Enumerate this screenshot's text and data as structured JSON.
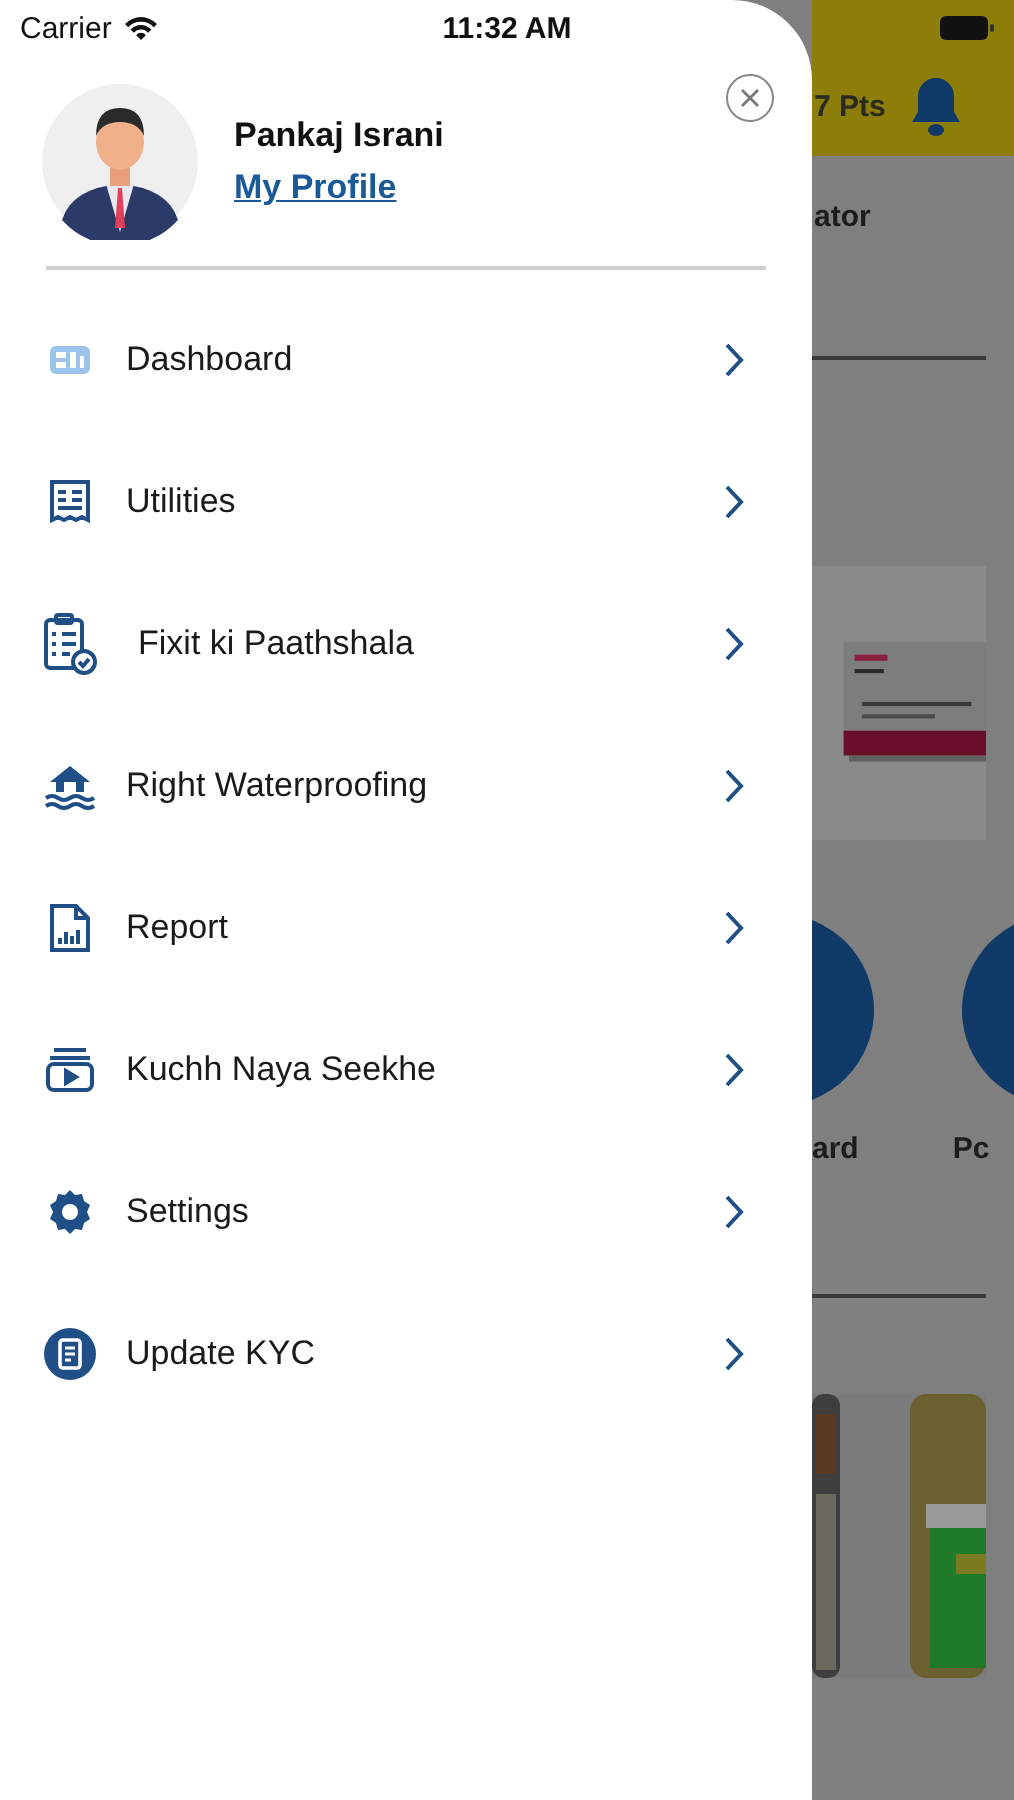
{
  "status_bar": {
    "carrier": "Carrier",
    "time": "11:32 AM"
  },
  "drawer": {
    "profile": {
      "name": "Pankaj Israni",
      "link": "My Profile"
    },
    "menu": [
      {
        "label": "Dashboard",
        "kind": "dashboard"
      },
      {
        "label": "Utilities",
        "kind": "receipt"
      },
      {
        "label": "Fixit ki Paathshala",
        "kind": "checklist"
      },
      {
        "label": "Right Waterproofing",
        "kind": "house"
      },
      {
        "label": "Report",
        "kind": "report"
      },
      {
        "label": "Kuchh Naya Seekhe",
        "kind": "video"
      },
      {
        "label": "Settings",
        "kind": "gear"
      },
      {
        "label": "Update KYC",
        "kind": "document"
      }
    ]
  },
  "background": {
    "points": "7 Pts",
    "section_title": "ator",
    "shortcut_labels": [
      "ard",
      "Pc"
    ]
  }
}
